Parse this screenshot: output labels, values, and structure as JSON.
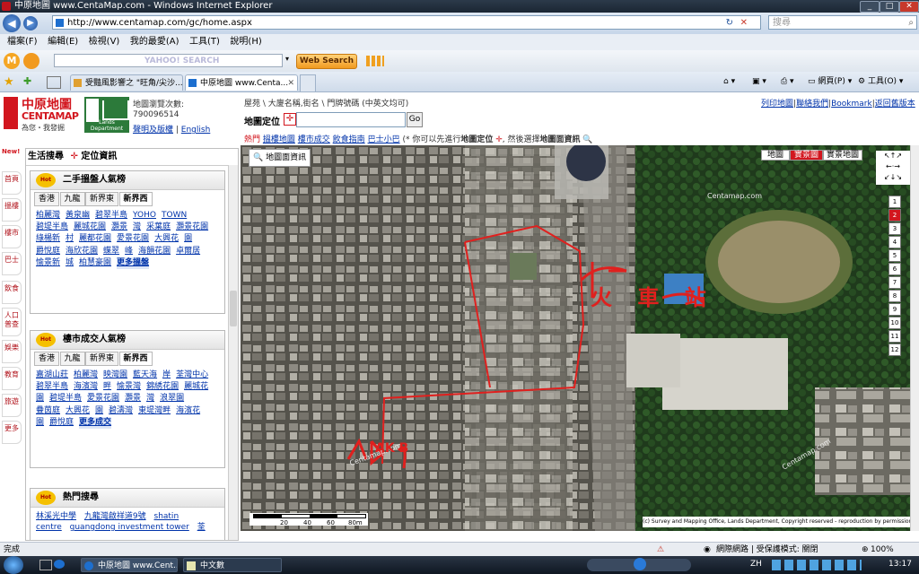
{
  "window": {
    "title": "中原地圖 www.CentaMap.com - Windows Internet Explorer"
  },
  "address": {
    "url": "http://www.centamap.com/gc/home.aspx",
    "search_placeholder": "搜尋"
  },
  "menu": [
    "檔案(F)",
    "編輯(E)",
    "檢視(V)",
    "我的最愛(A)",
    "工具(T)",
    "說明(H)"
  ],
  "yahoo": {
    "placeholder": "YAHOO! SEARCH",
    "web_search": "Web Search"
  },
  "tabs": [
    {
      "label": "受豔風影響之 \"旺角/尖沙..."
    },
    {
      "label": "中原地圖 www.Centa..."
    }
  ],
  "tab_tools": {
    "page": "網頁(P)",
    "tools": "工具(O)"
  },
  "header": {
    "logo_cn": "中原地圖",
    "logo_en": "CENTAMAP",
    "logo_slogan": "為您・我發掘",
    "lands_dept": "Lands Department",
    "visit_label": "地圖瀏覽次數:",
    "visit_count": "790096514",
    "disclaimer": "聲明及版權",
    "english": "English",
    "search_hint": "屋苑 \\ 大廈名稱,街名 \\ 門牌號碼 (中英文均可)",
    "locate_label": "地圖定位",
    "go": "Go",
    "hot_label": "熱門",
    "hot_links": [
      "搵樓地圖",
      "樓市成交",
      "飲食指南",
      "巴士小巴"
    ],
    "hot_note": "(* 你可以先進行",
    "hot_note_bold": "地圖定位",
    "hot_note2": ", 然後選擇",
    "hot_note_bold2": "地圖面資訊",
    "top_links": [
      "列印地圖",
      "聯絡我們",
      "Bookmark",
      "返回舊版本"
    ]
  },
  "rail": [
    "New!",
    "首頁",
    "搵樓",
    "樓市",
    "巴士",
    "飲食",
    "人口普查",
    "娛樂",
    "教育",
    "旅遊",
    "更多"
  ],
  "panel": {
    "title1": "生活搜尋",
    "title2": "定位資訊",
    "box1": {
      "title": "二手搵盤人氣榜",
      "tabs": [
        "香港",
        "九龍",
        "新界東",
        "新界西"
      ],
      "items": [
        "柏麗灣",
        "黃泉幽",
        "碧翠半島",
        "YOHO",
        "TOWN",
        "碧堤半島",
        "麗城花園",
        "灝景",
        "灣",
        "采葉庭",
        "灝景花園",
        "綠楊新",
        "村",
        "麗都花園",
        "愛景花園",
        "大興花",
        "園",
        "爵悅庭",
        "海欣花園",
        "蝶翠",
        "峰",
        "海韻花園",
        "卓爾居",
        "愉景新",
        "城",
        "柏慧豪園"
      ],
      "more": "更多搵盤"
    },
    "box2": {
      "title": "樓市成交人氣榜",
      "tabs": [
        "香港",
        "九龍",
        "新界東",
        "新界西"
      ],
      "items": [
        "嘉湖山莊",
        "柏麗灣",
        "映灣園",
        "藍天海",
        "岸",
        "荃灣中心",
        "碧翠半島",
        "海濱灣",
        "畔",
        "愉景灣",
        "錦綉花園",
        "麗城花",
        "園",
        "碧堤半島",
        "愛景花園",
        "灝景",
        "灣",
        "浪翠園",
        "疊茵庭",
        "大興花",
        "園",
        "碧濤灣",
        "東堤灣畔",
        "海濱花",
        "園",
        "爵悅庭"
      ],
      "more": "更多成交"
    },
    "box3": {
      "title": "熱門搜尋",
      "items": [
        "林溪光中學",
        "九龍灣啟祥道9號",
        "shatin",
        "centre",
        "guangdong investment tower",
        "荃"
      ]
    }
  },
  "map": {
    "info_button": "地圖面資訊",
    "modes": [
      "地圖",
      "實景圖",
      "實景地圖"
    ],
    "active_mode": "實景圖",
    "zoom_levels": [
      "1",
      "2",
      "3",
      "4",
      "5",
      "6",
      "7",
      "8",
      "9",
      "10",
      "11",
      "12"
    ],
    "active_zoom": "2",
    "scale": [
      "20",
      "40",
      "60",
      "80m"
    ],
    "copyright": "(c) Survey and Mapping Office, Lands Department, Copyright reserved - reproduction by permission only.",
    "watermark": "Centamap.com",
    "annotation_a": "AK B",
    "annotation_b": "火 車 站"
  },
  "status": {
    "left": "完成",
    "zone": "網際網路 | 受保護模式: 關閉",
    "zoom": "100%"
  },
  "taskbar": {
    "tasks": [
      "中原地圖 www.Cent...",
      "中文數"
    ],
    "lang": "ZH",
    "time": "13:17"
  }
}
